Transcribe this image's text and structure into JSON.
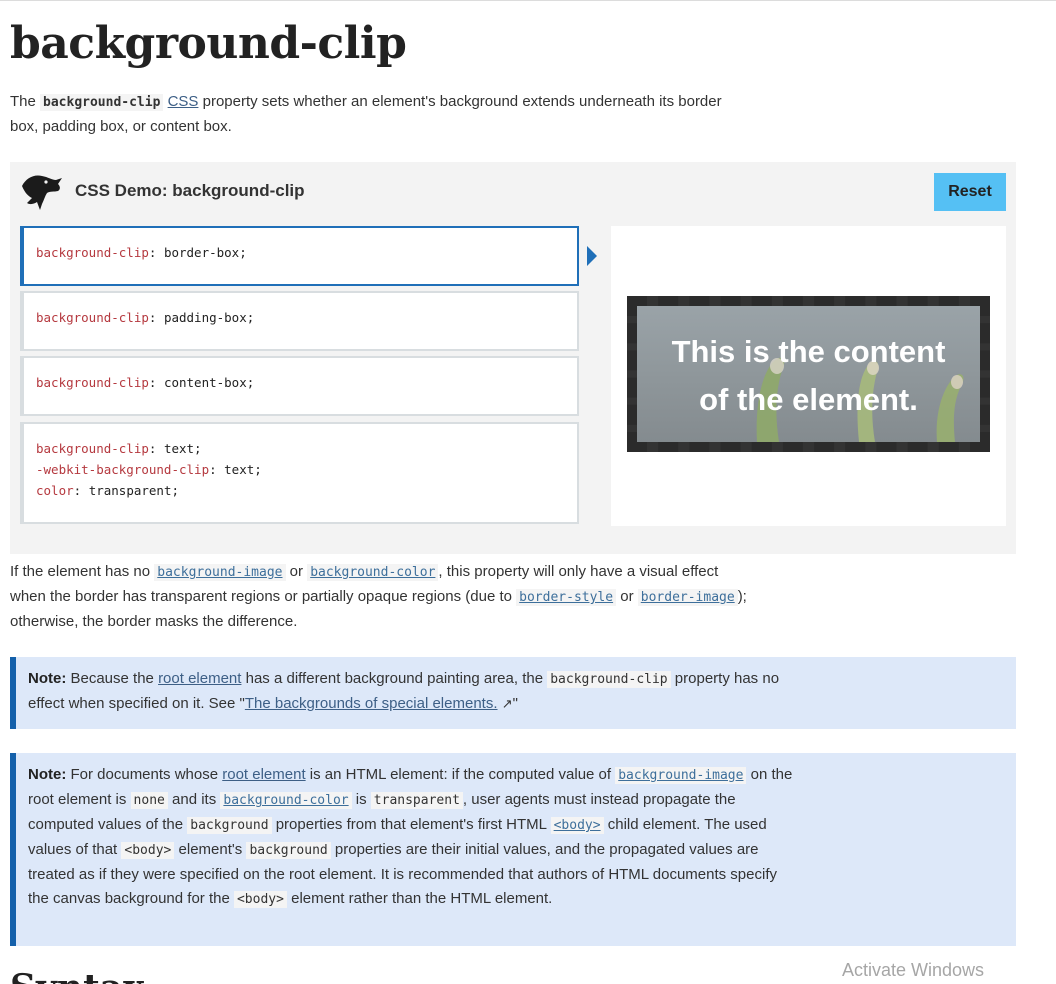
{
  "page": {
    "title": "background-clip"
  },
  "intro": {
    "p1": "The ",
    "code": "background-clip",
    "link": "CSS",
    "p2": " property sets whether an element's background extends underneath its border box, padding box, or content box."
  },
  "demo": {
    "title": "CSS Demo: background-clip",
    "reset_label": "Reset",
    "choices": [
      {
        "lines": [
          {
            "prop": "background-clip",
            "val": "border-box;"
          }
        ]
      },
      {
        "lines": [
          {
            "prop": "background-clip",
            "val": "padding-box;"
          }
        ]
      },
      {
        "lines": [
          {
            "prop": "background-clip",
            "val": "content-box;"
          }
        ]
      },
      {
        "lines": [
          {
            "prop": "background-clip",
            "val": "text;"
          },
          {
            "prop": "-webkit-background-clip",
            "val": "text;"
          },
          {
            "prop": "color",
            "val": "transparent;"
          }
        ]
      }
    ],
    "output_text_line1": "This is the content",
    "output_text_line2": "of the element."
  },
  "para2": {
    "t1": "If the element has no ",
    "c1": "background-image",
    "t2": " or ",
    "c2": "background-color",
    "t3": ", this property will only have a visual effect when the border has transparent regions or partially opaque regions (due to ",
    "c3": "border-style",
    "t4": " or ",
    "c4": "border-image",
    "t5": "); otherwise, the border masks the difference."
  },
  "note1": {
    "label": "Note:",
    "t1": " Because the ",
    "l1": "root element",
    "t2": " has a different background painting area, the ",
    "c1": "background-clip",
    "t3": " property has no effect when specified on it. See \"",
    "l2": "The backgrounds of special elements.",
    "t4": "\""
  },
  "note2": {
    "label": "Note:",
    "t1": " For documents whose ",
    "l1": "root element",
    "t2": " is an HTML element: if the computed value of ",
    "c1": "background-image",
    "t3": " on the root element is ",
    "c2": "none",
    "t4": " and its ",
    "c3": "background-color",
    "t5": " is ",
    "c4": "transparent",
    "t6": ", user agents must instead propagate the computed values of the ",
    "c5": "background",
    "t7": " properties from that element's first HTML ",
    "c6": "<body>",
    "t8": " child element. The used values of that ",
    "c7": "<body>",
    "t9": " element's ",
    "c8": "background",
    "t10": " properties are their initial values, and the propagated values are treated as if they were specified on the root element. It is recommended that authors of HTML documents specify the canvas background for the ",
    "c9": "<body>",
    "t11": " element rather than the HTML element."
  },
  "next_heading": "Syntax",
  "watermark": "Activate Windows"
}
